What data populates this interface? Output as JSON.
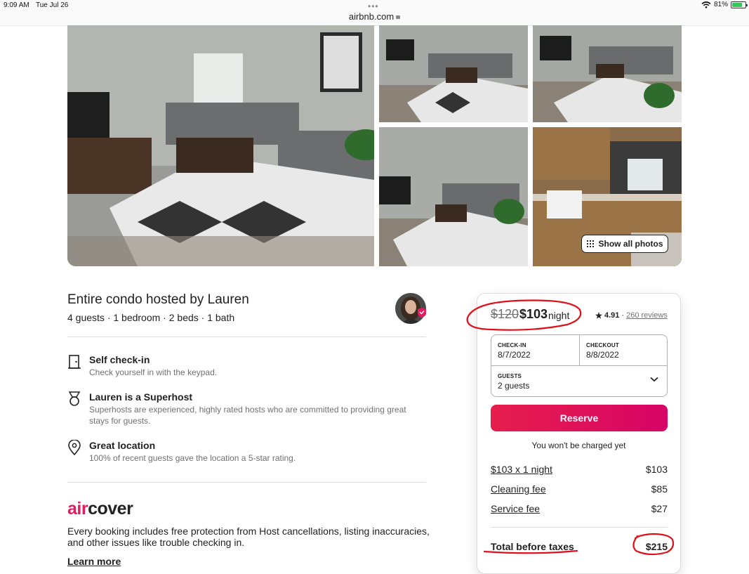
{
  "status_bar": {
    "time": "9:09 AM",
    "date": "Tue Jul 26",
    "url": "airbnb.com",
    "battery": "81%"
  },
  "gallery": {
    "show_all_label": "Show all photos"
  },
  "listing": {
    "title": "Entire condo hosted by Lauren",
    "subtitle": "4 guests · 1 bedroom · 2 beds · 1 bath",
    "features": [
      {
        "icon": "door-icon",
        "title": "Self check-in",
        "desc": "Check yourself in with the keypad."
      },
      {
        "icon": "superhost-medal-icon",
        "title": "Lauren is a Superhost",
        "desc": "Superhosts are experienced, highly rated hosts who are committed to providing great stays for guests."
      },
      {
        "icon": "map-pin-icon",
        "title": "Great location",
        "desc": "100% of recent guests gave the location a 5-star rating."
      }
    ],
    "aircover": {
      "air": "air",
      "cover": "cover",
      "text": "Every booking includes free protection from Host cancellations, listing inaccuracies, and other issues like trouble checking in.",
      "learn_more": "Learn more"
    }
  },
  "booking": {
    "price_old": "$120",
    "price_new": "$103",
    "price_unit": "night",
    "rating": "4.91",
    "rating_sep": "·",
    "reviews": "260 reviews",
    "checkin_label": "CHECK-IN",
    "checkin_value": "8/7/2022",
    "checkout_label": "CHECKOUT",
    "checkout_value": "8/8/2022",
    "guests_label": "GUESTS",
    "guests_value": "2 guests",
    "reserve_label": "Reserve",
    "no_charge_note": "You won't be charged yet",
    "fees": [
      {
        "label": "$103 x 1 night",
        "value": "$103"
      },
      {
        "label": "Cleaning fee",
        "value": "$85"
      },
      {
        "label": "Service fee",
        "value": "$27"
      }
    ],
    "total_label": "Total before taxes",
    "total_value": "$215"
  },
  "colors": {
    "brand": "#e31c5f",
    "reserve_start": "#e61e4d",
    "reserve_end": "#d70466",
    "markup_red": "#e0101a"
  }
}
